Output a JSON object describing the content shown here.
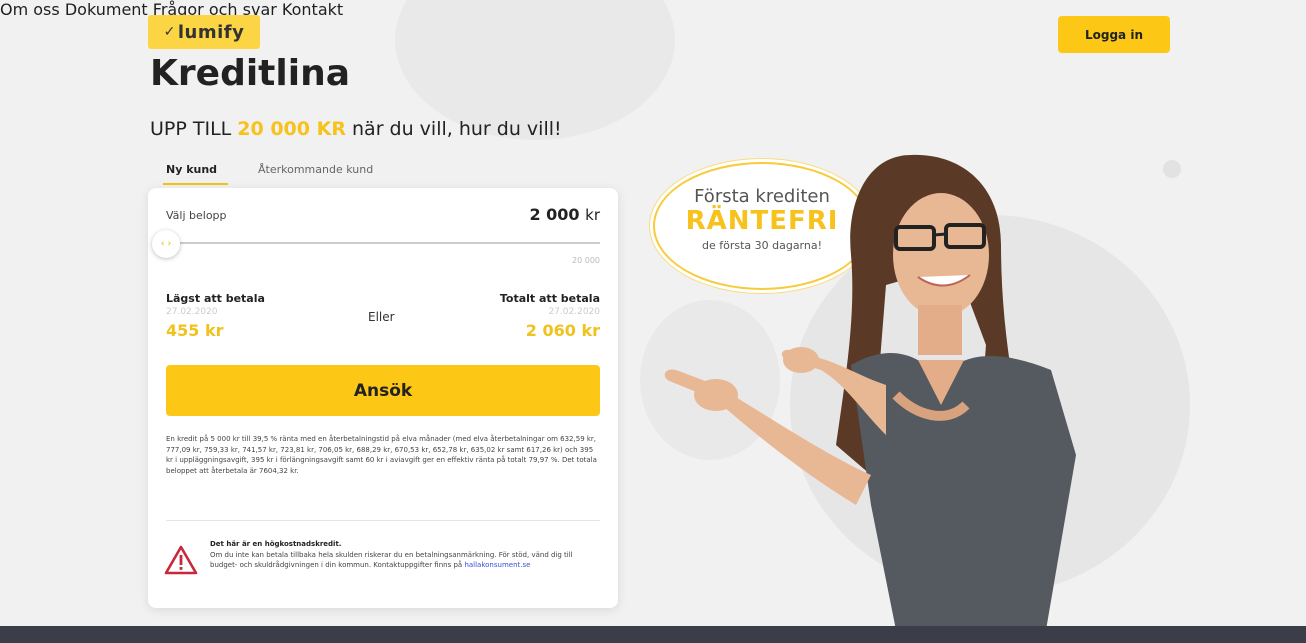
{
  "brand": {
    "logo_text": "lumify"
  },
  "nav": {
    "items": [
      "Om oss",
      "Dokument",
      "Frågor och svar",
      "Kontakt"
    ],
    "login_label": "Logga in"
  },
  "hero": {
    "title": "Kreditlina",
    "tagline_pre": "UPP TILL ",
    "tagline_highlight": "20 000 KR",
    "tagline_post": " när du vill, hur du vill!"
  },
  "tabs": {
    "active": "Ny kund",
    "inactive": "Återkommande kund"
  },
  "calculator": {
    "amount_label": "Välj belopp",
    "amount_value": "2 000",
    "amount_unit": "kr",
    "slider_max": "20 000",
    "slider_fraction": 0.0,
    "min_pay_title": "Lägst att betala",
    "min_pay_date": "27.02.2020",
    "min_pay_amount": "455 kr",
    "or_label": "Eller",
    "total_pay_title": "Totalt att betala",
    "total_pay_date": "27.02.2020",
    "total_pay_amount": "2 060 kr",
    "apply_label": "Ansök",
    "disclaimer": "En kredit på 5 000 kr till 39,5 % ränta med en återbetalningstid på elva månader (med elva återbetalningar om 632,59 kr, 777,09 kr, 759,33 kr, 741,57 kr, 723,81 kr, 706,05 kr, 688,29 kr, 670,53 kr, 652,78 kr, 635,02 kr samt 617,26 kr) och 395 kr i uppläggningsavgift, 395 kr i förlängningsavgift samt 60 kr i aviavgift ger en effektiv ränta på totalt 79,97 %. Det totala beloppet att återbetala är 7604,32 kr.",
    "warning_title": "Det här är en högkostnadskredit.",
    "warning_text": "Om du inte kan betala tillbaka hela skulden riskerar du en betalningsanmärkning. För stöd, vänd dig till budget- och skuldrådgivningen i din kommun. Kontaktuppgifter finns på ",
    "warning_link": "hallakonsument.se"
  },
  "badge": {
    "line1": "Första krediten",
    "line2": "RÄNTEFRI",
    "line3": "de första 30 dagarna!"
  },
  "colors": {
    "accent": "#fcc715",
    "highlight": "#f2c21c",
    "footer": "#3b3d48"
  }
}
